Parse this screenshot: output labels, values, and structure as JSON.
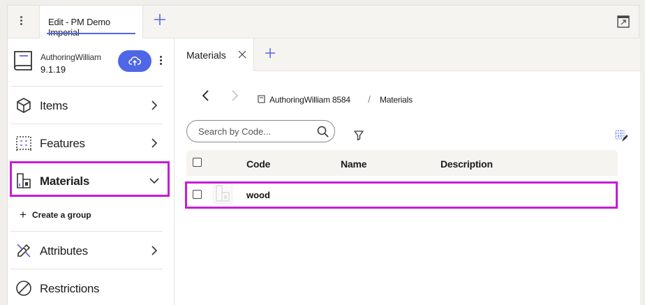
{
  "topbar": {
    "tab_label": "Edit - PM Demo Imperial"
  },
  "sidebar": {
    "project_name": "AuthoringWilliam",
    "project_version": "9.1.19",
    "items": [
      {
        "label": "Items"
      },
      {
        "label": "Features"
      },
      {
        "label": "Materials"
      },
      {
        "label": "Attributes"
      },
      {
        "label": "Restrictions"
      }
    ],
    "create_group_label": "Create a group"
  },
  "main": {
    "tab_label": "Materials",
    "breadcrumb": {
      "project": "AuthoringWilliam 8584",
      "separator": "/",
      "current": "Materials"
    },
    "search": {
      "placeholder": "Search by Code..."
    },
    "table": {
      "columns": [
        "Code",
        "Name",
        "Description"
      ],
      "rows": [
        {
          "code": "wood",
          "name": "",
          "description": ""
        }
      ]
    }
  },
  "colors": {
    "accent": "#4f67e6",
    "highlight": "#c61bd9"
  },
  "icons": [
    "kebab-icon",
    "plus-icon",
    "window-icon",
    "book-icon",
    "cloud-upload-icon",
    "cube-icon",
    "features-icon",
    "materials-icon",
    "chevron-right-icon",
    "chevron-down-icon",
    "attributes-icon",
    "restrictions-icon",
    "close-icon",
    "arrow-left-icon",
    "arrow-right-icon",
    "search-icon",
    "filter-icon",
    "grid-settings-icon"
  ]
}
